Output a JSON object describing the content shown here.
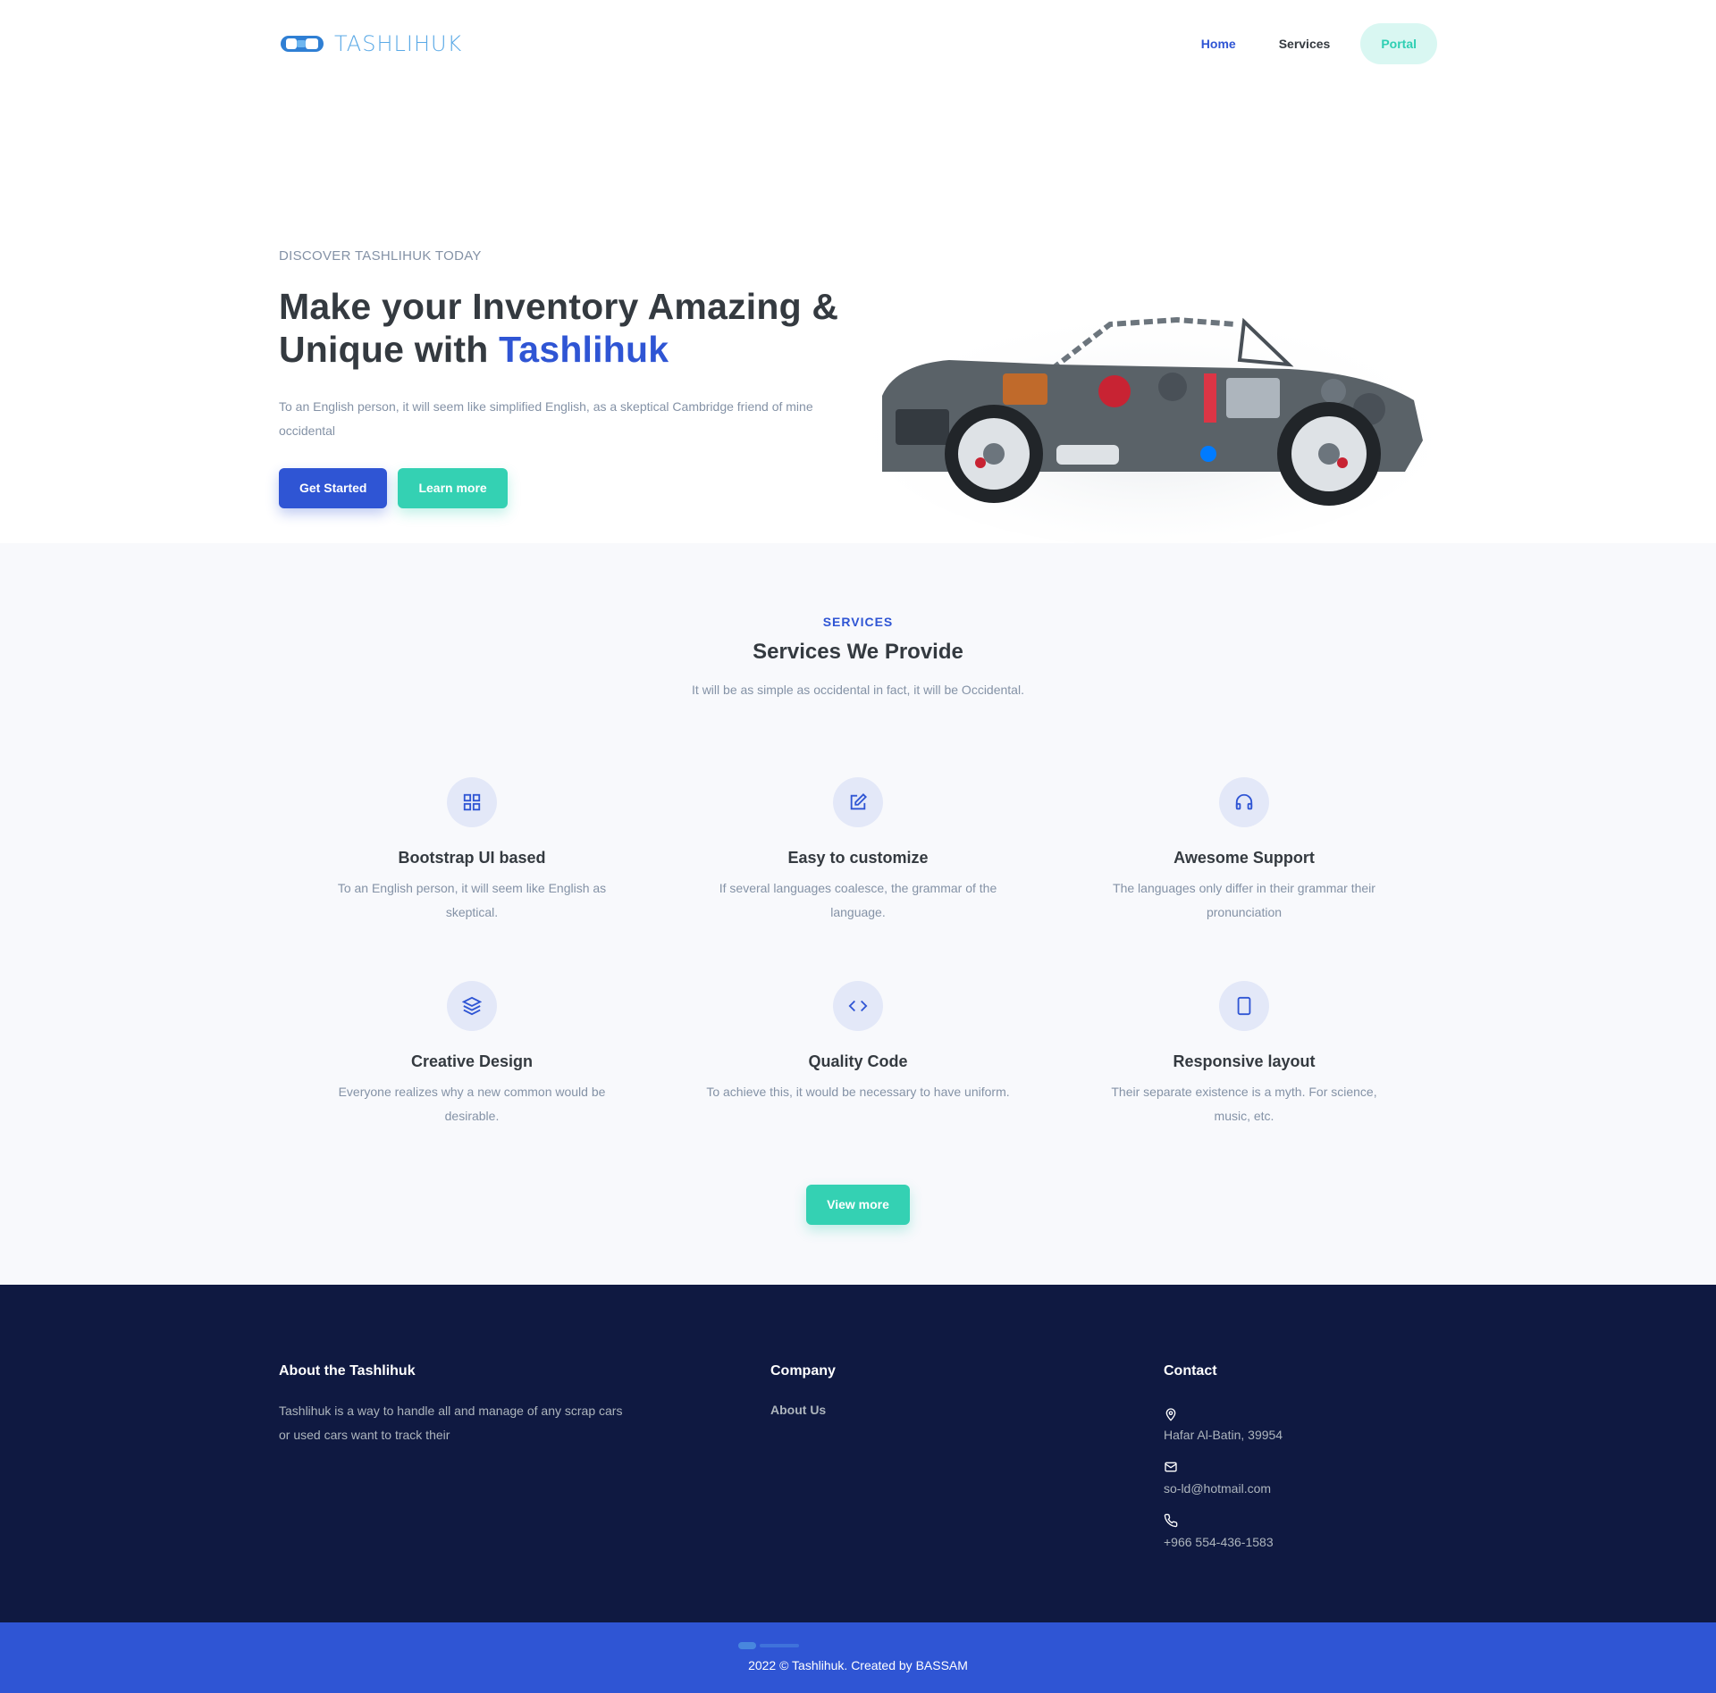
{
  "nav": {
    "logo_text": "TASHLIHUK",
    "items": [
      {
        "label": "Home"
      },
      {
        "label": "Services"
      },
      {
        "label": "Portal"
      }
    ]
  },
  "hero": {
    "eyebrow": "DISCOVER TASHLIHUK TODAY",
    "title_line1": "Make your Inventory Amazing &",
    "title_line2_prefix": "Unique with ",
    "title_brand": "Tashlihuk",
    "lead": "To an English person, it will seem like simplified English, as a skeptical Cambridge friend of mine occidental",
    "primary_button": "Get Started",
    "secondary_button": "Learn more"
  },
  "services": {
    "tag": "SERVICES",
    "title": "Services We Provide",
    "subtitle": "It will be as simple as occidental in fact, it will be Occidental.",
    "items": [
      {
        "icon": "grid-icon",
        "title": "Bootstrap UI based",
        "text": "To an English person, it will seem like English as skeptical."
      },
      {
        "icon": "edit-icon",
        "title": "Easy to customize",
        "text": "If several languages coalesce, the grammar of the language."
      },
      {
        "icon": "headphones-icon",
        "title": "Awesome Support",
        "text": "The languages only differ in their grammar their pronunciation"
      },
      {
        "icon": "layers-icon",
        "title": "Creative Design",
        "text": "Everyone realizes why a new common would be desirable."
      },
      {
        "icon": "code-icon",
        "title": "Quality Code",
        "text": "To achieve this, it would be necessary to have uniform."
      },
      {
        "icon": "tablet-icon",
        "title": "Responsive layout",
        "text": "Their separate existence is a myth. For science, music, etc."
      }
    ],
    "view_more": "View more"
  },
  "footer": {
    "about_title": "About the Tashlihuk",
    "about_text": "Tashlihuk is a way to handle all and manage of any scrap cars or used cars want to track their",
    "company_title": "Company",
    "company_link": "About Us",
    "contact_title": "Contact",
    "address": "Hafar Al-Batin, 39954",
    "email": "so-ld@hotmail.com",
    "phone": "+966 554-436-1583",
    "copyright": "2022 © Tashlihuk. Created by BASSAM"
  },
  "colors": {
    "primary": "#2f55d4",
    "teal": "#34d1b3",
    "footer_bg": "#0f1941",
    "muted": "#8492a6"
  }
}
